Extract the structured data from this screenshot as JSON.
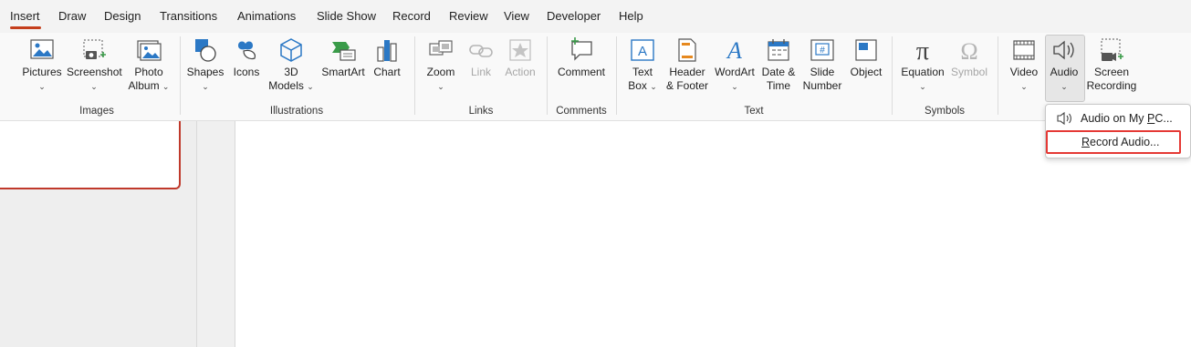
{
  "tabs": [
    {
      "label": "Insert",
      "active": true
    },
    {
      "label": "Draw"
    },
    {
      "label": "Design"
    },
    {
      "label": "Transitions"
    },
    {
      "label": "Animations"
    },
    {
      "label": "Slide Show"
    },
    {
      "label": "Record"
    },
    {
      "label": "Review"
    },
    {
      "label": "View"
    },
    {
      "label": "Developer"
    },
    {
      "label": "Help"
    }
  ],
  "groups": {
    "images": "Images",
    "illustrations": "Illustrations",
    "links": "Links",
    "comments": "Comments",
    "text": "Text",
    "symbols": "Symbols"
  },
  "buttons": {
    "pictures": {
      "line1": "Pictures",
      "caret": "⌄"
    },
    "screenshot": {
      "line1": "Screenshot",
      "caret": "⌄"
    },
    "photo_album": {
      "line1": "Photo",
      "line2": "Album",
      "caret": "⌄"
    },
    "shapes": {
      "line1": "Shapes",
      "caret": "⌄"
    },
    "icons": {
      "line1": "Icons"
    },
    "models": {
      "line1": "3D",
      "line2": "Models",
      "caret": "⌄"
    },
    "smartart": {
      "line1": "SmartArt"
    },
    "chart": {
      "line1": "Chart"
    },
    "zoom": {
      "line1": "Zoom",
      "caret": "⌄"
    },
    "link": {
      "line1": "Link"
    },
    "action": {
      "line1": "Action"
    },
    "comment": {
      "line1": "Comment"
    },
    "text_box": {
      "line1": "Text",
      "line2": "Box",
      "caret": "⌄"
    },
    "header_footer": {
      "line1": "Header",
      "line2": "& Footer"
    },
    "wordart": {
      "line1": "WordArt",
      "caret": "⌄"
    },
    "date_time": {
      "line1": "Date &",
      "line2": "Time"
    },
    "slide_number": {
      "line1": "Slide",
      "line2": "Number"
    },
    "object": {
      "line1": "Object"
    },
    "equation": {
      "line1": "Equation",
      "caret": "⌄"
    },
    "symbol": {
      "line1": "Symbol"
    },
    "video": {
      "line1": "Video",
      "caret": "⌄"
    },
    "audio": {
      "line1": "Audio",
      "caret": "⌄"
    },
    "screen_recording": {
      "line1": "Screen",
      "line2": "Recording"
    }
  },
  "audio_menu": {
    "items": [
      {
        "label_pre": "Audio on My ",
        "label_ul": "P",
        "label_post": "C..."
      },
      {
        "label_pre": "",
        "label_ul": "R",
        "label_post": "ecord Audio..."
      }
    ]
  },
  "colors": {
    "accent": "#c43e1c",
    "highlight_border": "#e53935",
    "icon_blue": "#2b78c5",
    "icon_green": "#3a9b49"
  }
}
